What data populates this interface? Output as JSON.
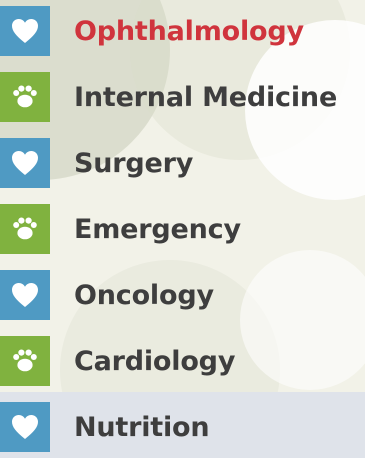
{
  "menu": {
    "items": [
      {
        "label": "Ophthalmology",
        "icon": "heart-icon",
        "color": "#4f9ac3",
        "active": true
      },
      {
        "label": "Internal Medicine",
        "icon": "paw-icon",
        "color": "#80b23f",
        "active": false
      },
      {
        "label": "Surgery",
        "icon": "heart-icon",
        "color": "#4f9ac3",
        "active": false
      },
      {
        "label": "Emergency",
        "icon": "paw-icon",
        "color": "#80b23f",
        "active": false
      },
      {
        "label": "Oncology",
        "icon": "heart-icon",
        "color": "#4f9ac3",
        "active": false
      },
      {
        "label": "Cardiology",
        "icon": "paw-icon",
        "color": "#80b23f",
        "active": false
      },
      {
        "label": "Nutrition",
        "icon": "heart-icon",
        "color": "#4f9ac3",
        "active": false
      }
    ]
  },
  "colors": {
    "active_text": "#d0343d",
    "default_text": "#3e3e3e",
    "heart_bg": "#4f9ac3",
    "paw_bg": "#80b23f"
  }
}
